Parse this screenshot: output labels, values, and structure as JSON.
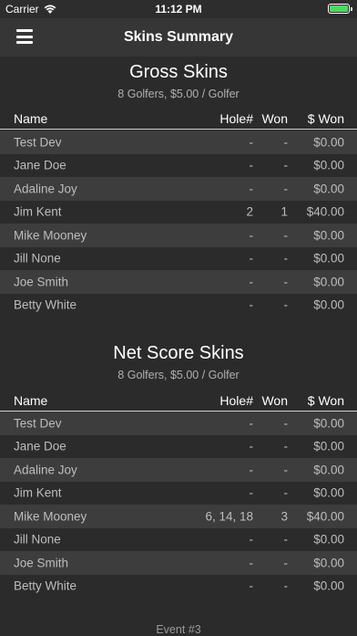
{
  "status_bar": {
    "carrier": "Carrier",
    "time": "11:12 PM"
  },
  "nav": {
    "title": "Skins Summary"
  },
  "columns": {
    "name": "Name",
    "hole": "Hole#",
    "won": "Won",
    "amount": "$ Won"
  },
  "gross": {
    "title": "Gross Skins",
    "subtitle": "8  Golfers, $5.00 / Golfer",
    "rows": [
      {
        "name": "Test Dev",
        "hole": "-",
        "won": "-",
        "amount": "$0.00"
      },
      {
        "name": "Jane Doe",
        "hole": "-",
        "won": "-",
        "amount": "$0.00"
      },
      {
        "name": "Adaline Joy",
        "hole": "-",
        "won": "-",
        "amount": "$0.00"
      },
      {
        "name": "Jim Kent",
        "hole": "2",
        "won": "1",
        "amount": "$40.00"
      },
      {
        "name": "Mike Mooney",
        "hole": "-",
        "won": "-",
        "amount": "$0.00"
      },
      {
        "name": "Jill None",
        "hole": "-",
        "won": "-",
        "amount": "$0.00"
      },
      {
        "name": "Joe Smith",
        "hole": "-",
        "won": "-",
        "amount": "$0.00"
      },
      {
        "name": "Betty White",
        "hole": "-",
        "won": "-",
        "amount": "$0.00"
      }
    ]
  },
  "net": {
    "title": "Net Score Skins",
    "subtitle": "8 Golfers, $5.00 / Golfer",
    "rows": [
      {
        "name": "Test Dev",
        "hole": "-",
        "won": "-",
        "amount": "$0.00"
      },
      {
        "name": "Jane Doe",
        "hole": "-",
        "won": "-",
        "amount": "$0.00"
      },
      {
        "name": "Adaline Joy",
        "hole": "-",
        "won": "-",
        "amount": "$0.00"
      },
      {
        "name": "Jim Kent",
        "hole": "-",
        "won": "-",
        "amount": "$0.00"
      },
      {
        "name": "Mike Mooney",
        "hole": "6, 14, 18",
        "won": "3",
        "amount": "$40.00"
      },
      {
        "name": "Jill None",
        "hole": "-",
        "won": "-",
        "amount": "$0.00"
      },
      {
        "name": "Joe Smith",
        "hole": "-",
        "won": "-",
        "amount": "$0.00"
      },
      {
        "name": "Betty White",
        "hole": "-",
        "won": "-",
        "amount": "$0.00"
      }
    ]
  },
  "footer": {
    "text": "Event #3"
  }
}
